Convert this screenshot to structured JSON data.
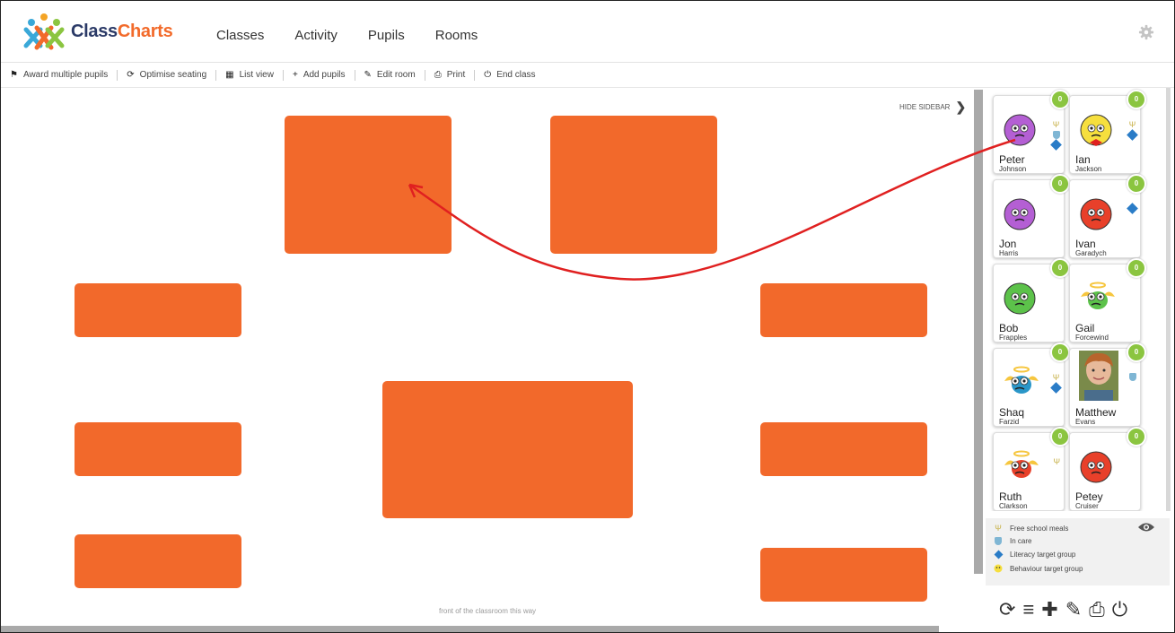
{
  "app": {
    "logo_part1": "Class",
    "logo_part2": "Charts",
    "nav": [
      "Classes",
      "Activity",
      "Pupils",
      "Rooms"
    ]
  },
  "toolbar": [
    {
      "icon": "flag-icon",
      "glyph": "⚑",
      "label": "Award multiple pupils"
    },
    {
      "icon": "optimise-icon",
      "glyph": "⟳",
      "label": "Optimise seating"
    },
    {
      "icon": "list-view-icon",
      "glyph": "▦",
      "label": "List view"
    },
    {
      "icon": "plus-icon",
      "glyph": "+",
      "label": "Add pupils"
    },
    {
      "icon": "pencil-icon",
      "glyph": "✎",
      "label": "Edit room"
    },
    {
      "icon": "print-icon",
      "glyph": "⎙",
      "label": "Print"
    },
    {
      "icon": "power-icon",
      "glyph": "⏻",
      "label": "End class"
    }
  ],
  "room": {
    "hide_sidebar": "HIDE SIDEBAR",
    "front_label": "front of the classroom this way"
  },
  "pupils": [
    {
      "first": "Peter",
      "last": "Johnson",
      "points": "0",
      "face": "purple",
      "icons": [
        "fork",
        "shield",
        "book"
      ]
    },
    {
      "first": "Ian",
      "last": "Jackson",
      "points": "0",
      "face": "yellow",
      "icons": [
        "fork",
        "book"
      ]
    },
    {
      "first": "Jon",
      "last": "Harris",
      "points": "0",
      "face": "purple",
      "icons": []
    },
    {
      "first": "Ivan",
      "last": "Garadych",
      "points": "0",
      "face": "red",
      "icons": [
        "book"
      ]
    },
    {
      "first": "Bob",
      "last": "Frapples",
      "points": "0",
      "face": "green",
      "icons": []
    },
    {
      "first": "Gail",
      "last": "Forcewind",
      "points": "0",
      "face": "green-angel",
      "icons": []
    },
    {
      "first": "Shaq",
      "last": "Farzid",
      "points": "0",
      "face": "blue-angel",
      "icons": [
        "fork",
        "book"
      ]
    },
    {
      "first": "Matthew",
      "last": "Evans",
      "points": "0",
      "face": "photo",
      "icons": [
        "shield"
      ]
    },
    {
      "first": "Ruth",
      "last": "Clarkson",
      "points": "0",
      "face": "red-angel",
      "icons": [
        "fork"
      ]
    },
    {
      "first": "Petey",
      "last": "Cruiser",
      "points": "0",
      "face": "red",
      "icons": []
    }
  ],
  "legend": [
    {
      "icon": "fork",
      "label": "Free school meals"
    },
    {
      "icon": "shield",
      "label": "In care"
    },
    {
      "icon": "book",
      "label": "Literacy target group"
    },
    {
      "icon": "smiley",
      "label": "Behaviour target group"
    }
  ],
  "colors": {
    "desk": "#f2692b",
    "badge": "#8bc540",
    "arrow": "#e02020",
    "brand_dark": "#2b3a67",
    "brand_orange": "#f26a2a"
  }
}
